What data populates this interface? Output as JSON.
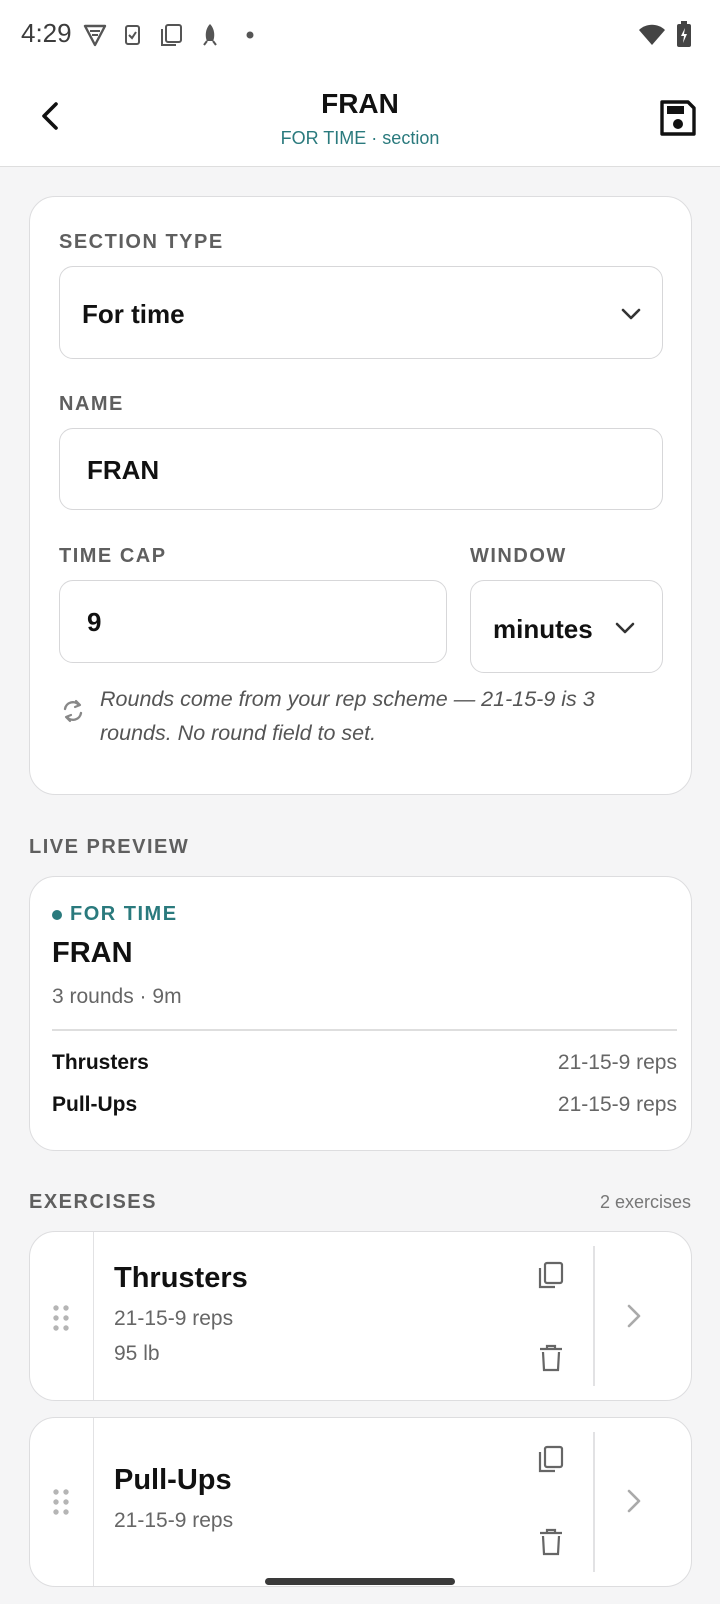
{
  "status_bar": {
    "time": "4:29"
  },
  "app_bar": {
    "title": "FRAN",
    "subtitle": "FOR TIME · section"
  },
  "form": {
    "section_type_label": "SECTION TYPE",
    "section_type_value": "For time",
    "name_label": "NAME",
    "name_value": "FRAN",
    "time_cap_label": "TIME CAP",
    "time_cap_value": "9",
    "window_label": "WINDOW",
    "window_value": "minutes",
    "note": "Rounds come from your rep scheme — 21-15-9 is 3 rounds. No round field to set."
  },
  "live_preview": {
    "section_label": "LIVE PREVIEW",
    "kicker": "FOR TIME",
    "title": "FRAN",
    "meta": "3 rounds · 9m",
    "rows": [
      {
        "name": "Thrusters",
        "value": "21-15-9 reps"
      },
      {
        "name": "Pull-Ups",
        "value": "21-15-9 reps"
      }
    ]
  },
  "exercises": {
    "section_label": "EXERCISES",
    "count": "2 exercises",
    "items": [
      {
        "name": "Thrusters",
        "reps": "21-15-9 reps",
        "load": "95 lb"
      },
      {
        "name": "Pull-Ups",
        "reps": "21-15-9 reps"
      }
    ]
  },
  "colors": {
    "accent": "#2a7a7d",
    "background": "#f5f5f6",
    "card": "#ffffff"
  }
}
